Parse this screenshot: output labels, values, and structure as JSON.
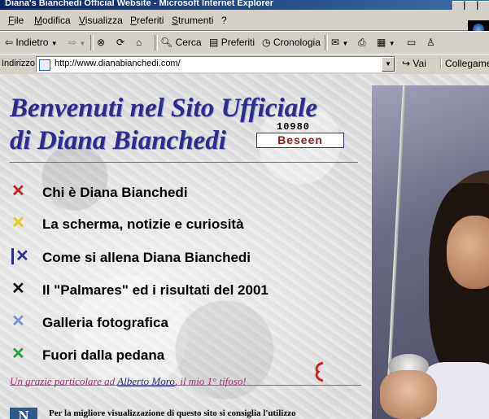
{
  "window": {
    "title": "Diana's Bianchedi Official Website - Microsoft Internet Explorer"
  },
  "menubar": {
    "items": [
      "File",
      "Modifica",
      "Visualizza",
      "Preferiti",
      "Strumenti",
      "?"
    ]
  },
  "toolbar": {
    "back": "Indietro",
    "search": "Cerca",
    "favorites": "Preferiti",
    "history": "Cronologia"
  },
  "address": {
    "label": "Indirizzo",
    "url": "http://www.dianabianchedi.com/",
    "go": "Vai",
    "links": "Collegamenti"
  },
  "page": {
    "title_line1": "Benvenuti nel Sito Ufficiale",
    "title_line2": "di Diana Bianchedi",
    "counter": "10980",
    "beseen": "Beseen",
    "nav": [
      {
        "label": "Chi è Diana Bianchedi",
        "color": "#cc2020"
      },
      {
        "label": "La scherma, notizie e curiosità",
        "color": "#e0d010"
      },
      {
        "label": "Come si allena Diana Bianchedi",
        "color": "#2c2c9a"
      },
      {
        "label": "Il \"Palmares\" ed i risultati del 2001",
        "color": "#101010"
      },
      {
        "label": "Galleria fotografica",
        "color": "#7a90d0"
      },
      {
        "label": "Fuori dalla pedana",
        "color": "#20a040"
      }
    ],
    "thanks_prefix": "Un grazie particolare ad ",
    "thanks_link": "Alberto Moro",
    "thanks_suffix": ", il mio 1° tifoso!",
    "best_view": "Per la migliore visualizzazione di questo sito si consiglia l'utilizzo",
    "n_icon": "N"
  }
}
